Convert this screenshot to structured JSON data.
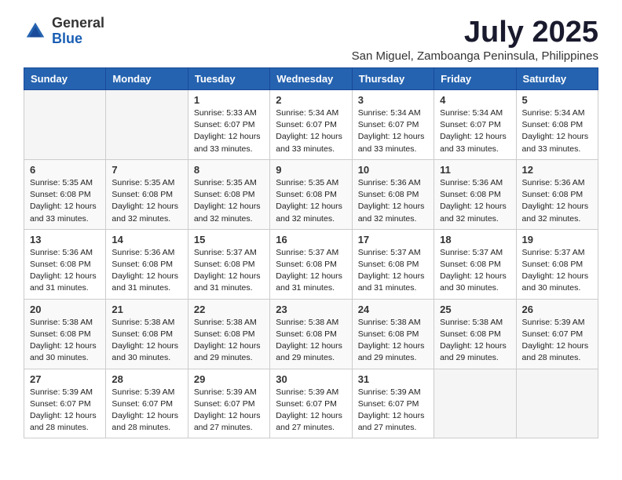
{
  "logo": {
    "general": "General",
    "blue": "Blue"
  },
  "title": "July 2025",
  "location": "San Miguel, Zamboanga Peninsula, Philippines",
  "days_of_week": [
    "Sunday",
    "Monday",
    "Tuesday",
    "Wednesday",
    "Thursday",
    "Friday",
    "Saturday"
  ],
  "weeks": [
    [
      {
        "day": "",
        "info": ""
      },
      {
        "day": "",
        "info": ""
      },
      {
        "day": "1",
        "info": "Sunrise: 5:33 AM\nSunset: 6:07 PM\nDaylight: 12 hours\nand 33 minutes."
      },
      {
        "day": "2",
        "info": "Sunrise: 5:34 AM\nSunset: 6:07 PM\nDaylight: 12 hours\nand 33 minutes."
      },
      {
        "day": "3",
        "info": "Sunrise: 5:34 AM\nSunset: 6:07 PM\nDaylight: 12 hours\nand 33 minutes."
      },
      {
        "day": "4",
        "info": "Sunrise: 5:34 AM\nSunset: 6:07 PM\nDaylight: 12 hours\nand 33 minutes."
      },
      {
        "day": "5",
        "info": "Sunrise: 5:34 AM\nSunset: 6:08 PM\nDaylight: 12 hours\nand 33 minutes."
      }
    ],
    [
      {
        "day": "6",
        "info": "Sunrise: 5:35 AM\nSunset: 6:08 PM\nDaylight: 12 hours\nand 33 minutes."
      },
      {
        "day": "7",
        "info": "Sunrise: 5:35 AM\nSunset: 6:08 PM\nDaylight: 12 hours\nand 32 minutes."
      },
      {
        "day": "8",
        "info": "Sunrise: 5:35 AM\nSunset: 6:08 PM\nDaylight: 12 hours\nand 32 minutes."
      },
      {
        "day": "9",
        "info": "Sunrise: 5:35 AM\nSunset: 6:08 PM\nDaylight: 12 hours\nand 32 minutes."
      },
      {
        "day": "10",
        "info": "Sunrise: 5:36 AM\nSunset: 6:08 PM\nDaylight: 12 hours\nand 32 minutes."
      },
      {
        "day": "11",
        "info": "Sunrise: 5:36 AM\nSunset: 6:08 PM\nDaylight: 12 hours\nand 32 minutes."
      },
      {
        "day": "12",
        "info": "Sunrise: 5:36 AM\nSunset: 6:08 PM\nDaylight: 12 hours\nand 32 minutes."
      }
    ],
    [
      {
        "day": "13",
        "info": "Sunrise: 5:36 AM\nSunset: 6:08 PM\nDaylight: 12 hours\nand 31 minutes."
      },
      {
        "day": "14",
        "info": "Sunrise: 5:36 AM\nSunset: 6:08 PM\nDaylight: 12 hours\nand 31 minutes."
      },
      {
        "day": "15",
        "info": "Sunrise: 5:37 AM\nSunset: 6:08 PM\nDaylight: 12 hours\nand 31 minutes."
      },
      {
        "day": "16",
        "info": "Sunrise: 5:37 AM\nSunset: 6:08 PM\nDaylight: 12 hours\nand 31 minutes."
      },
      {
        "day": "17",
        "info": "Sunrise: 5:37 AM\nSunset: 6:08 PM\nDaylight: 12 hours\nand 31 minutes."
      },
      {
        "day": "18",
        "info": "Sunrise: 5:37 AM\nSunset: 6:08 PM\nDaylight: 12 hours\nand 30 minutes."
      },
      {
        "day": "19",
        "info": "Sunrise: 5:37 AM\nSunset: 6:08 PM\nDaylight: 12 hours\nand 30 minutes."
      }
    ],
    [
      {
        "day": "20",
        "info": "Sunrise: 5:38 AM\nSunset: 6:08 PM\nDaylight: 12 hours\nand 30 minutes."
      },
      {
        "day": "21",
        "info": "Sunrise: 5:38 AM\nSunset: 6:08 PM\nDaylight: 12 hours\nand 30 minutes."
      },
      {
        "day": "22",
        "info": "Sunrise: 5:38 AM\nSunset: 6:08 PM\nDaylight: 12 hours\nand 29 minutes."
      },
      {
        "day": "23",
        "info": "Sunrise: 5:38 AM\nSunset: 6:08 PM\nDaylight: 12 hours\nand 29 minutes."
      },
      {
        "day": "24",
        "info": "Sunrise: 5:38 AM\nSunset: 6:08 PM\nDaylight: 12 hours\nand 29 minutes."
      },
      {
        "day": "25",
        "info": "Sunrise: 5:38 AM\nSunset: 6:08 PM\nDaylight: 12 hours\nand 29 minutes."
      },
      {
        "day": "26",
        "info": "Sunrise: 5:39 AM\nSunset: 6:07 PM\nDaylight: 12 hours\nand 28 minutes."
      }
    ],
    [
      {
        "day": "27",
        "info": "Sunrise: 5:39 AM\nSunset: 6:07 PM\nDaylight: 12 hours\nand 28 minutes."
      },
      {
        "day": "28",
        "info": "Sunrise: 5:39 AM\nSunset: 6:07 PM\nDaylight: 12 hours\nand 28 minutes."
      },
      {
        "day": "29",
        "info": "Sunrise: 5:39 AM\nSunset: 6:07 PM\nDaylight: 12 hours\nand 27 minutes."
      },
      {
        "day": "30",
        "info": "Sunrise: 5:39 AM\nSunset: 6:07 PM\nDaylight: 12 hours\nand 27 minutes."
      },
      {
        "day": "31",
        "info": "Sunrise: 5:39 AM\nSunset: 6:07 PM\nDaylight: 12 hours\nand 27 minutes."
      },
      {
        "day": "",
        "info": ""
      },
      {
        "day": "",
        "info": ""
      }
    ]
  ]
}
